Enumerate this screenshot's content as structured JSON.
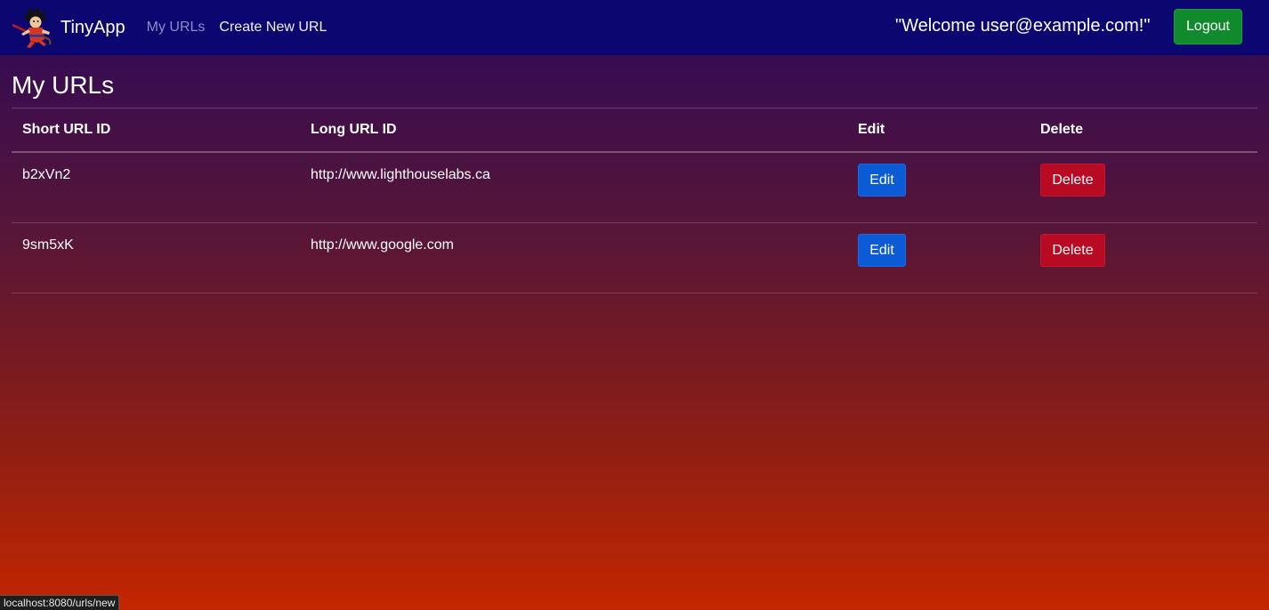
{
  "navbar": {
    "brand": "TinyApp",
    "logo_icon": "cartoon-character-logo-icon",
    "links": [
      {
        "label": "My URLs"
      },
      {
        "label": "Create New URL"
      }
    ],
    "welcome": "\"Welcome user@example.com!\"",
    "logout_label": "Logout",
    "colors": {
      "background": "#0c0770",
      "logout": "#118a2e"
    }
  },
  "main": {
    "title": "My URLs",
    "table": {
      "headers": [
        "Short URL ID",
        "Long URL ID",
        "Edit",
        "Delete"
      ],
      "rows": [
        {
          "short": "b2xVn2",
          "long": "http://www.lighthouselabs.ca",
          "edit": "Edit",
          "delete": "Delete"
        },
        {
          "short": "9sm5xK",
          "long": "http://www.google.com",
          "edit": "Edit",
          "delete": "Delete"
        }
      ]
    },
    "colors": {
      "edit": "#0b5ad6",
      "delete": "#b80a22"
    }
  },
  "status_bar": {
    "url": "localhost:8080/urls/new"
  }
}
